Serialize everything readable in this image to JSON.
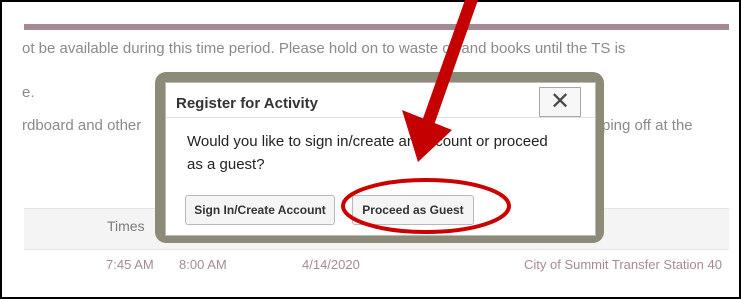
{
  "background": {
    "line1": "ot be available during this time period.  Please hold on to waste oil and books until the TS is",
    "line2": "e.",
    "line3": "rdboard and other",
    "line3_right": "ping off at the",
    "table": {
      "times_header": "Times",
      "row": {
        "start": "7:45 AM",
        "end": "8:00 AM",
        "date": "4/14/2020",
        "location": "City of Summit Transfer Station 40"
      }
    }
  },
  "modal": {
    "title": "Register for Activity",
    "close_glyph": "✕",
    "message": "Would you like to sign in/create an account or proceed as a guest?",
    "buttons": {
      "sign_in": "Sign In/Create Account",
      "guest": "Proceed as Guest"
    }
  },
  "colors": {
    "accent_bar": "#a58a96",
    "modal_frame": "#8d8a78",
    "annotation_red": "#cc0000"
  }
}
